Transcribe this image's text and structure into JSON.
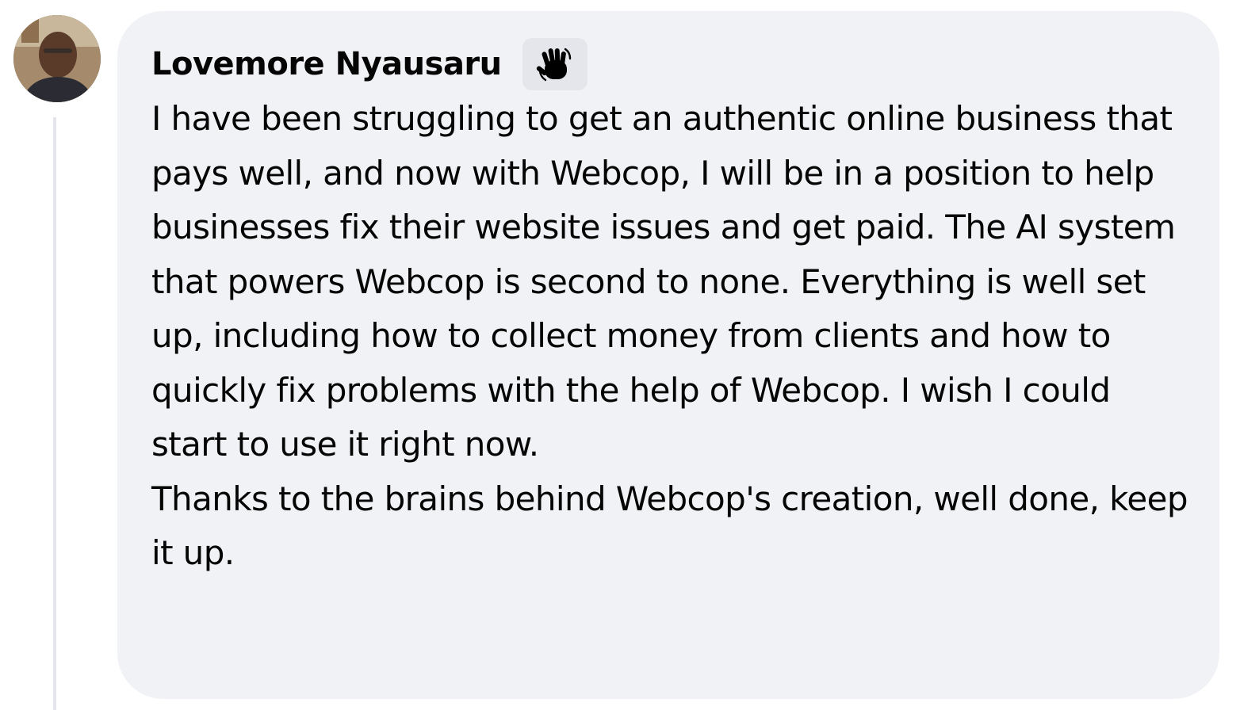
{
  "comment": {
    "author": "Lovemore Nyausaru",
    "badge_icon": "waving-hand-icon",
    "paragraphs": [
      "I have been struggling to get an authentic online business that pays well, and now with Webcop, I will be in a position to help businesses fix their website issues and get paid. The AI system that powers Webcop is second to none. Everything is well set up, including how to collect money from clients and how to quickly fix problems with the help of Webcop. I wish I could start to use it right now.",
      "Thanks to the brains behind Webcop's creation, well done, keep it up."
    ]
  },
  "colors": {
    "bubble_background": "#f0f2f5",
    "thread_line": "#e4e6eb",
    "text": "#050505"
  }
}
